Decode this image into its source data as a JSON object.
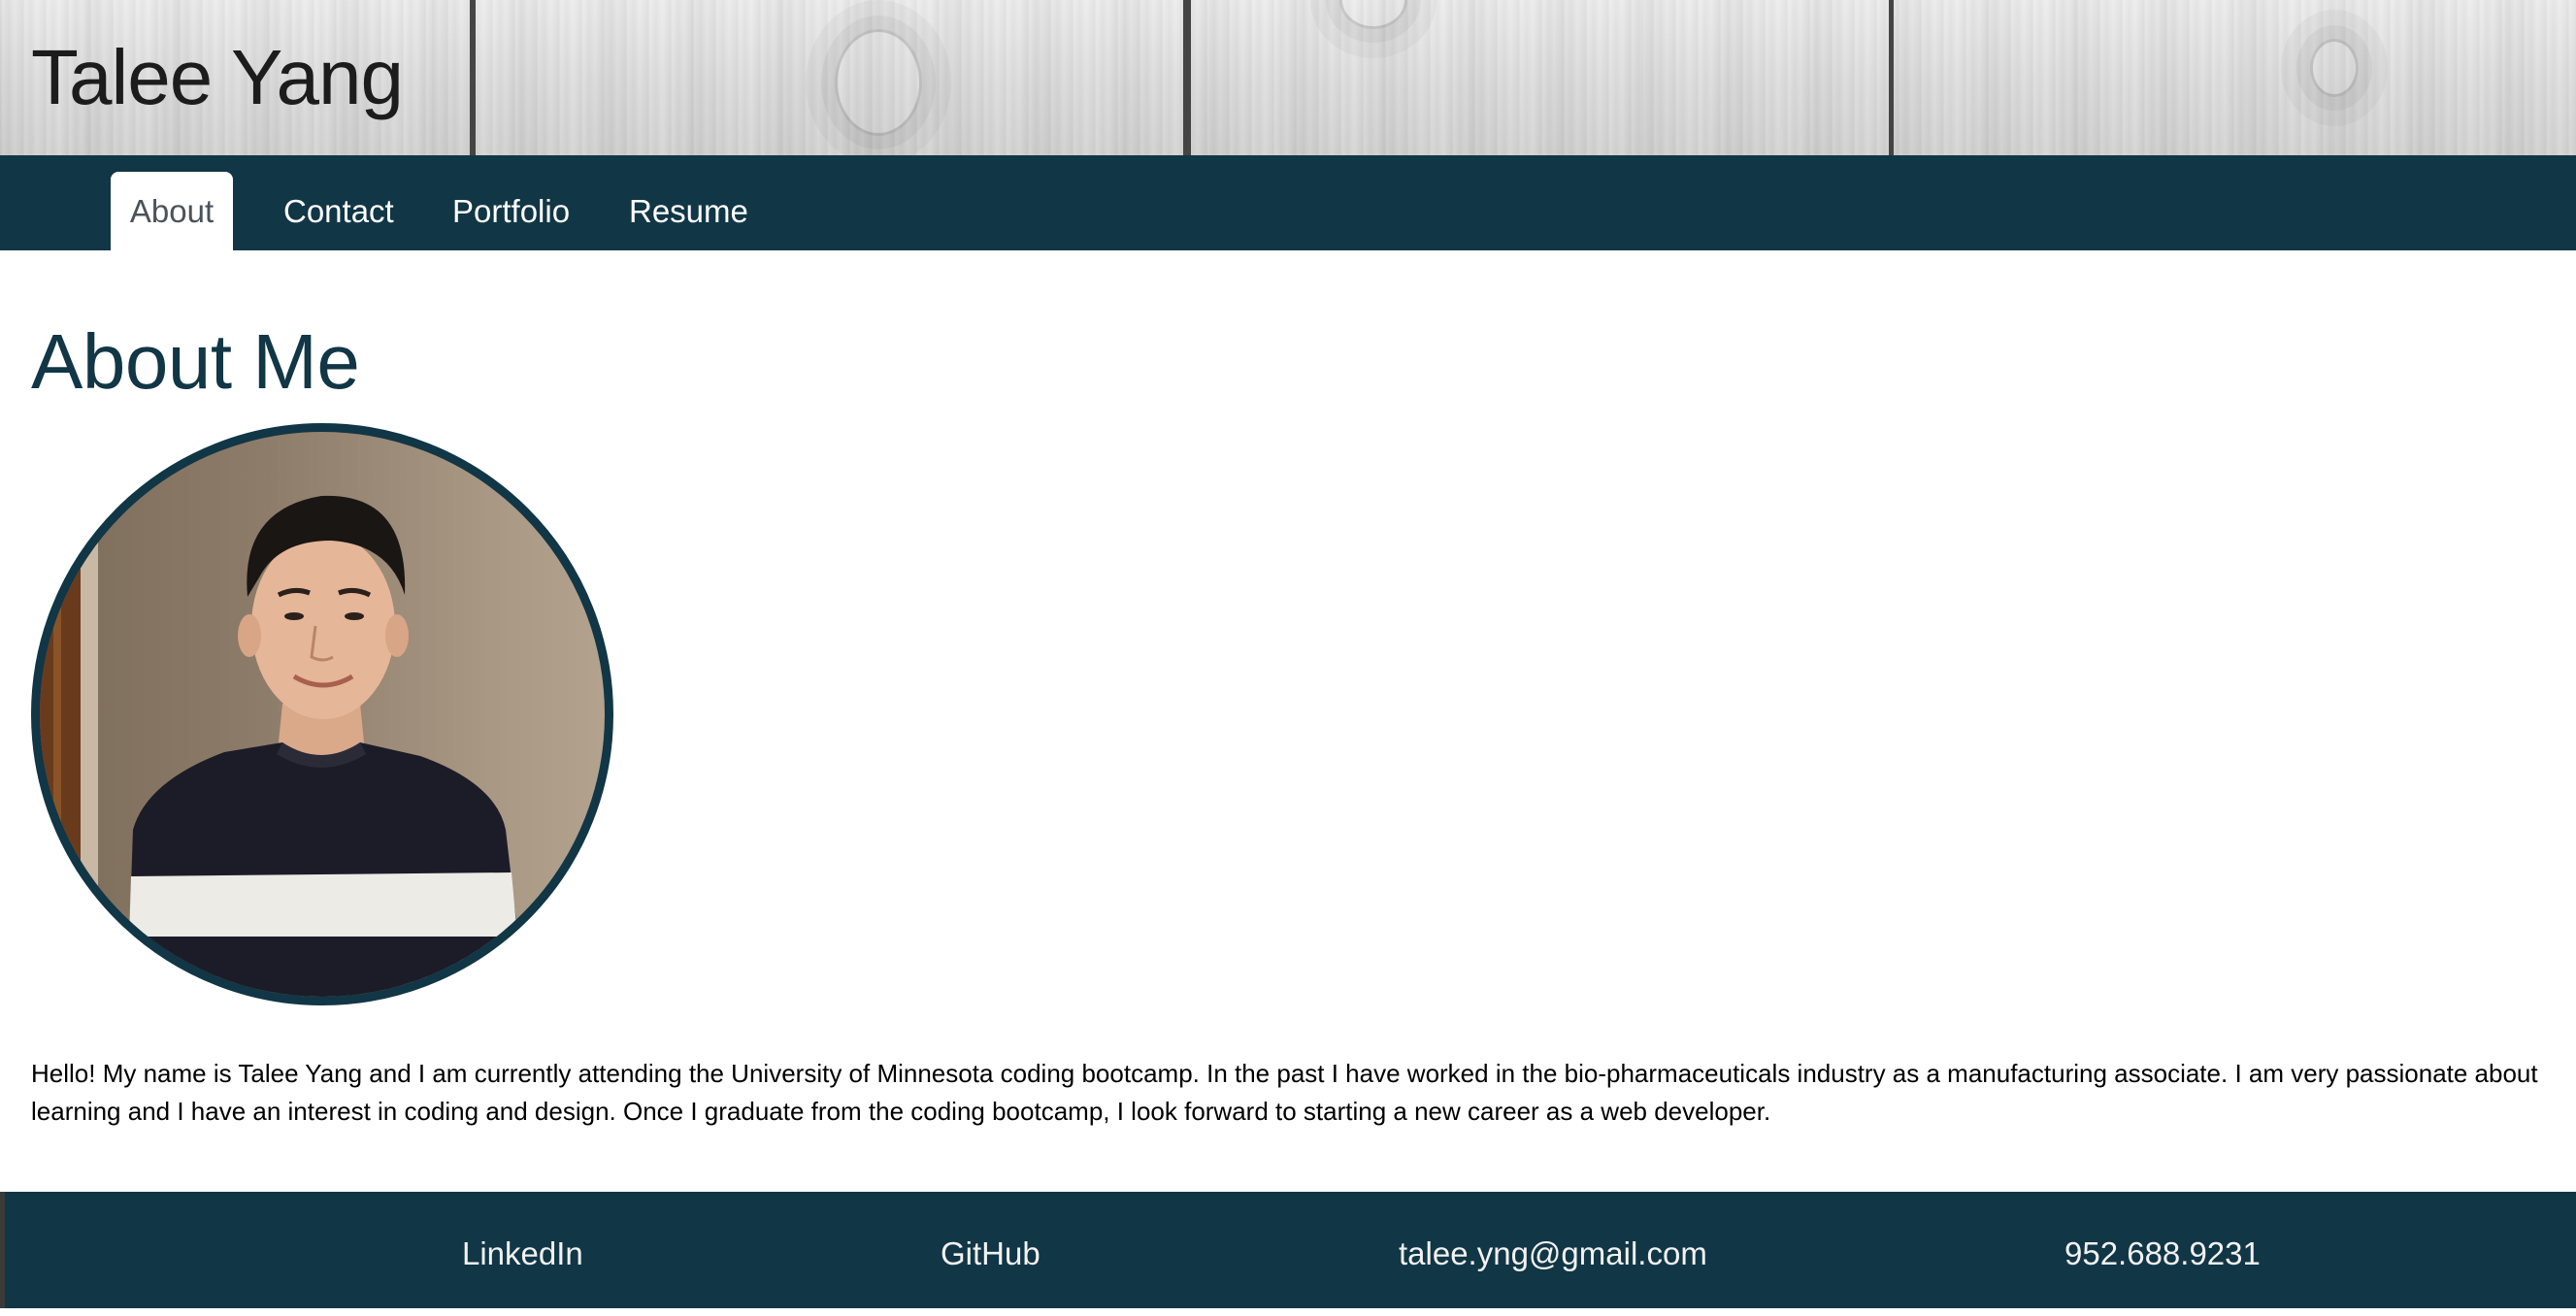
{
  "header": {
    "title": "Talee Yang"
  },
  "nav": {
    "tabs": [
      {
        "label": "About",
        "active": true
      },
      {
        "label": "Contact",
        "active": false
      },
      {
        "label": "Portfolio",
        "active": false
      },
      {
        "label": "Resume",
        "active": false
      }
    ]
  },
  "main": {
    "heading": "About Me",
    "bio": "Hello! My name is Talee Yang and I am currently attending the University of Minnesota coding bootcamp. In the past I have worked in the bio-pharmaceuticals industry as a manufacturing associate. I am very passionate about learning and I have an interest in coding and design. Once I graduate from the coding bootcamp, I look forward to starting a new career as a web developer."
  },
  "footer": {
    "linkedin": "LinkedIn",
    "github": "GitHub",
    "email": "talee.yng@gmail.com",
    "phone": "952.688.9231"
  },
  "colors": {
    "primary": "#113646",
    "header_wood": "#dcdcdc",
    "active_tab_text": "#4a5359"
  },
  "icons": {
    "profile_photo": "profile-photo-circle"
  }
}
